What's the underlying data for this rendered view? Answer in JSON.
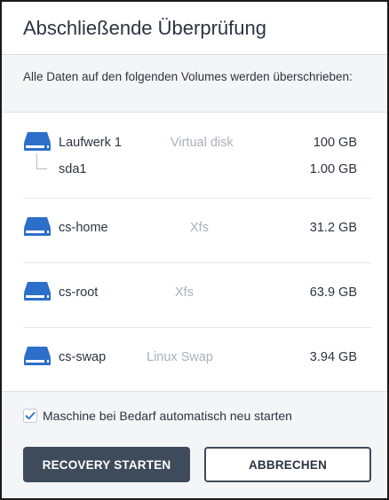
{
  "dialog": {
    "title": "Abschließende Überprüfung",
    "warning": "Alle Daten auf den folgenden Volumes werden überschrieben:"
  },
  "volumes": [
    {
      "name": "Laufwerk 1",
      "type": "Virtual disk",
      "size": "100 GB",
      "icon": "disk-icon",
      "children": [
        {
          "name": "sda1",
          "size": "1.00 GB"
        }
      ]
    },
    {
      "name": "cs-home",
      "type": "Xfs",
      "size": "31.2 GB",
      "icon": "disk-icon"
    },
    {
      "name": "cs-root",
      "type": "Xfs",
      "size": "63.9 GB",
      "icon": "disk-icon"
    },
    {
      "name": "cs-swap",
      "type": "Linux Swap",
      "size": "3.94 GB",
      "icon": "disk-icon"
    }
  ],
  "options": {
    "restart_label": "Maschine bei Bedarf automatisch neu starten",
    "restart_checked": true
  },
  "buttons": {
    "primary": "RECOVERY STARTEN",
    "secondary": "ABBRECHEN"
  },
  "colors": {
    "accent_blue": "#2c6fc9",
    "button_dark": "#3e4b5a",
    "muted_text": "#a9b1ba"
  }
}
